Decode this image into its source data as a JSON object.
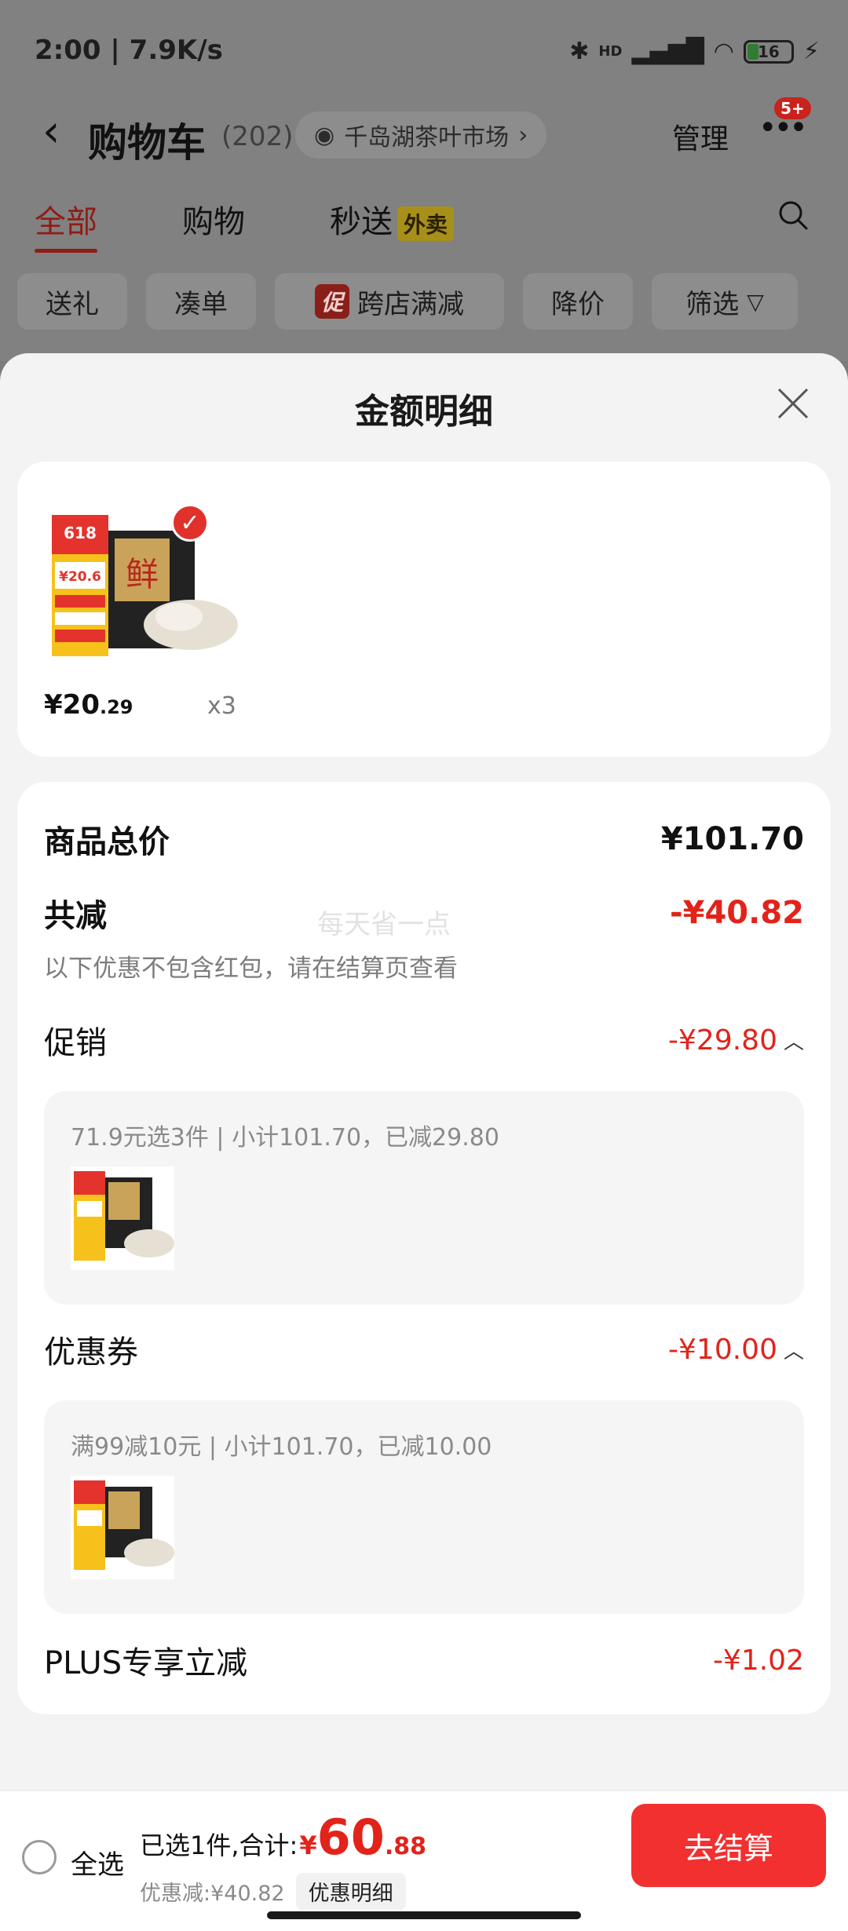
{
  "status_bar": {
    "time_speed": "2:00 | 7.9K/s",
    "battery": "16",
    "hd": "HD"
  },
  "cart_header": {
    "title": "购物车",
    "count": "(202)",
    "location": "千岛湖茶叶市场",
    "manage_label": "管理",
    "more_badge": "5+"
  },
  "tabs": [
    {
      "label": "全部",
      "active": true
    },
    {
      "label": "购物",
      "active": false
    },
    {
      "label": "秒送",
      "tag": "外卖",
      "active": false
    }
  ],
  "filters": [
    {
      "label": "送礼"
    },
    {
      "label": "凑单"
    },
    {
      "label": "跨店满减",
      "mark": "促"
    },
    {
      "label": "降价"
    },
    {
      "label": "筛选"
    }
  ],
  "sheet": {
    "title": "金额明细",
    "product": {
      "price_int": "¥20",
      "price_dec": ".29",
      "qty": "x3",
      "image_text": {
        "tag618": "618",
        "price_tag": "¥20.6",
        "brand": "鲜"
      }
    },
    "total_label": "商品总价",
    "total_value": "¥101.70",
    "discount_label": "共减",
    "discount_value": "-¥40.82",
    "watermark": "每天省一点",
    "note": "以下优惠不包含红包，请在结算页查看",
    "promo": {
      "label": "促销",
      "value": "-¥29.80",
      "detail": "71.9元选3件 | 小计101.70，已减29.80"
    },
    "coupon": {
      "label": "优惠券",
      "value": "-¥10.00",
      "detail": "满99减10元 | 小计101.70，已减10.00"
    },
    "plus": {
      "label": "PLUS专享立减",
      "value": "-¥1.02"
    }
  },
  "bottom_bar": {
    "select_all": "全选",
    "summary_prefix": "已选1件,合计:",
    "yen": "¥",
    "total_int": "60",
    "total_dec": ".88",
    "savings": "优惠减:¥40.82",
    "detail_chip": "优惠明细",
    "checkout": "去结算"
  },
  "colors": {
    "accent": "#e2231a",
    "checkout_bg": "#f23030",
    "overlay": "#818181"
  }
}
